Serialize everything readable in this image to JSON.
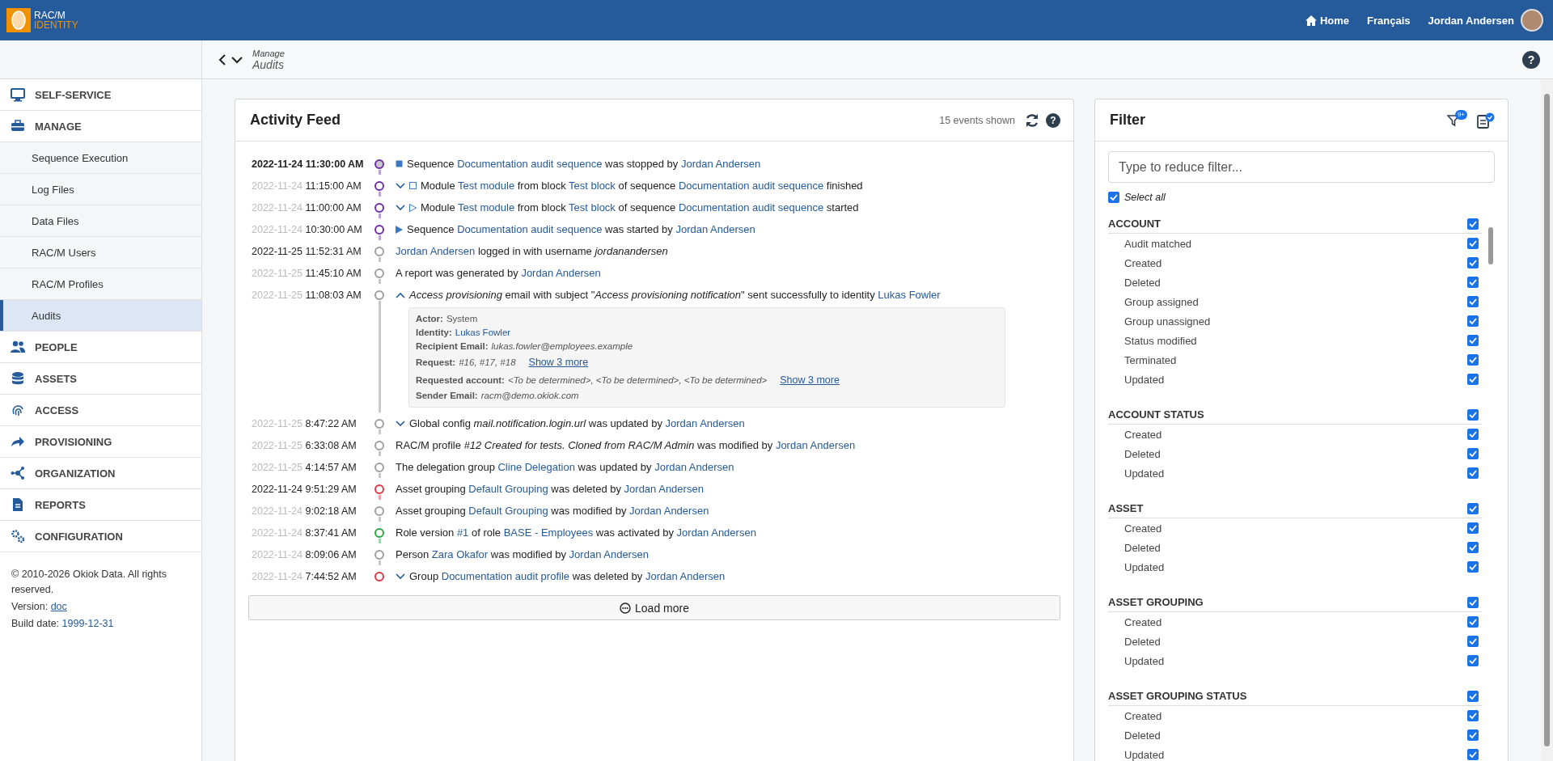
{
  "header": {
    "logo_line1": "RAC/M",
    "logo_line2": "IDENTITY",
    "nav": [
      {
        "label": "Home"
      },
      {
        "label": "Français"
      }
    ],
    "user": "Jordan Andersen"
  },
  "breadcrumb": {
    "parent": "Manage",
    "current": "Audits",
    "help": "?"
  },
  "sidebar": {
    "items": [
      {
        "label": "SELF-SERVICE"
      },
      {
        "label": "MANAGE",
        "children": [
          {
            "label": "Sequence Execution",
            "selected": false
          },
          {
            "label": "Log Files",
            "selected": false
          },
          {
            "label": "Data Files",
            "selected": false
          },
          {
            "label": "RAC/M Users",
            "selected": false
          },
          {
            "label": "RAC/M Profiles",
            "selected": false
          },
          {
            "label": "Audits",
            "selected": true
          }
        ]
      },
      {
        "label": "PEOPLE"
      },
      {
        "label": "ASSETS"
      },
      {
        "label": "ACCESS"
      },
      {
        "label": "PROVISIONING"
      },
      {
        "label": "ORGANIZATION"
      },
      {
        "label": "REPORTS"
      },
      {
        "label": "CONFIGURATION"
      }
    ],
    "footer": {
      "copyright": "© 2010-2026 Okiok Data. All rights reserved.",
      "version_label": "Version:",
      "version_link": "doc",
      "build_label": "Build date:",
      "build_value": "1999-12-31"
    }
  },
  "activity_feed": {
    "title": "Activity Feed",
    "count": "15 events shown",
    "help": "?",
    "load_more": "Load more",
    "events": [
      {
        "date": "2022-11-24",
        "time": "11:30:00 AM",
        "highlighted": true,
        "date_muted": false,
        "color": "#6f2da8",
        "expandable": false,
        "kind": "stop",
        "parts": [
          {
            "kind": "text",
            "text": "Sequence "
          },
          {
            "kind": "link",
            "text": "Documentation audit sequence"
          },
          {
            "kind": "text",
            "text": " was stopped by "
          },
          {
            "kind": "link",
            "text": "Jordan Andersen"
          }
        ]
      },
      {
        "date": "2022-11-24",
        "time": "11:15:00 AM",
        "highlighted": false,
        "date_muted": true,
        "color": "#6f2da8",
        "expandable": true,
        "expanded": false,
        "kind": "finish",
        "parts": [
          {
            "kind": "text",
            "text": "Module "
          },
          {
            "kind": "link",
            "text": "Test module"
          },
          {
            "kind": "text",
            "text": " from block "
          },
          {
            "kind": "link",
            "text": "Test block"
          },
          {
            "kind": "text",
            "text": " of sequence "
          },
          {
            "kind": "link",
            "text": "Documentation audit sequence"
          },
          {
            "kind": "text",
            "text": " finished"
          }
        ]
      },
      {
        "date": "2022-11-24",
        "time": "11:00:00 AM",
        "highlighted": false,
        "date_muted": true,
        "color": "#6f2da8",
        "expandable": true,
        "expanded": false,
        "kind": "begin",
        "parts": [
          {
            "kind": "text",
            "text": "Module "
          },
          {
            "kind": "link",
            "text": "Test module"
          },
          {
            "kind": "text",
            "text": " from block "
          },
          {
            "kind": "link",
            "text": "Test block"
          },
          {
            "kind": "text",
            "text": " of sequence "
          },
          {
            "kind": "link",
            "text": "Documentation audit sequence"
          },
          {
            "kind": "text",
            "text": " started"
          }
        ]
      },
      {
        "date": "2022-11-24",
        "time": "10:30:00 AM",
        "highlighted": false,
        "date_muted": true,
        "color": "#6f2da8",
        "expandable": false,
        "kind": "launch",
        "parts": [
          {
            "kind": "text",
            "text": "Sequence "
          },
          {
            "kind": "link",
            "text": "Documentation audit sequence"
          },
          {
            "kind": "text",
            "text": " was started by "
          },
          {
            "kind": "link",
            "text": "Jordan Andersen"
          }
        ]
      },
      {
        "date": "2022-11-25",
        "time": "11:52:31 AM",
        "highlighted": false,
        "date_muted": false,
        "color": "#9e9e9e",
        "expandable": false,
        "kind": "plain",
        "parts": [
          {
            "kind": "link",
            "text": "Jordan Andersen"
          },
          {
            "kind": "text",
            "text": " logged in with username "
          },
          {
            "kind": "italic",
            "text": "jordanandersen"
          }
        ]
      },
      {
        "date": "2022-11-25",
        "time": "11:45:10 AM",
        "highlighted": false,
        "date_muted": true,
        "color": "#9e9e9e",
        "expandable": false,
        "kind": "plain",
        "parts": [
          {
            "kind": "text",
            "text": "A report was generated by "
          },
          {
            "kind": "link",
            "text": "Jordan Andersen"
          }
        ]
      },
      {
        "date": "2022-11-25",
        "time": "11:08:03 AM",
        "highlighted": false,
        "date_muted": true,
        "color": "#9e9e9e",
        "expandable": true,
        "expanded": true,
        "kind": "plain",
        "parts": [
          {
            "kind": "italic",
            "text": "Access provisioning"
          },
          {
            "kind": "text",
            "text": " email with subject \""
          },
          {
            "kind": "italic",
            "text": "Access provisioning notification"
          },
          {
            "kind": "text",
            "text": "\" sent successfully to identity "
          },
          {
            "kind": "link",
            "text": "Lukas Fowler"
          }
        ],
        "details": [
          {
            "label": "Actor:",
            "value": "System",
            "kind": "text"
          },
          {
            "label": "Identity:",
            "value": "Lukas Fowler",
            "kind": "link"
          },
          {
            "label": "Recipient Email:",
            "value": "lukas.fowler@employees.example",
            "kind": "italic"
          },
          {
            "label": "Request:",
            "value": "#16, #17, #18",
            "kind": "italic",
            "more": "Show 3 more"
          },
          {
            "label": "Requested account:",
            "value": "<To be determined>, <To be determined>, <To be determined>",
            "kind": "italic",
            "more": "Show 3 more"
          },
          {
            "label": "Sender Email:",
            "value": "racm@demo.okiok.com",
            "kind": "italic"
          }
        ]
      },
      {
        "date": "2022-11-25",
        "time": "8:47:22 AM",
        "highlighted": false,
        "date_muted": true,
        "color": "#9e9e9e",
        "expandable": true,
        "expanded": false,
        "kind": "plain",
        "parts": [
          {
            "kind": "text",
            "text": "Global config "
          },
          {
            "kind": "italic",
            "text": "mail.notification.login.url"
          },
          {
            "kind": "text",
            "text": " was updated by "
          },
          {
            "kind": "link",
            "text": "Jordan Andersen"
          }
        ]
      },
      {
        "date": "2022-11-25",
        "time": "6:33:08 AM",
        "highlighted": false,
        "date_muted": true,
        "color": "#9e9e9e",
        "expandable": false,
        "kind": "plain",
        "parts": [
          {
            "kind": "text",
            "text": "RAC/M profile "
          },
          {
            "kind": "italic",
            "text": "#12 Created for tests. Cloned from RAC/M Admin"
          },
          {
            "kind": "text",
            "text": " was modified by "
          },
          {
            "kind": "link",
            "text": "Jordan Andersen"
          }
        ]
      },
      {
        "date": "2022-11-25",
        "time": "4:14:57 AM",
        "highlighted": false,
        "date_muted": true,
        "color": "#9e9e9e",
        "expandable": false,
        "kind": "plain",
        "parts": [
          {
            "kind": "text",
            "text": "The delegation group "
          },
          {
            "kind": "link",
            "text": "Cline Delegation"
          },
          {
            "kind": "text",
            "text": " was updated by "
          },
          {
            "kind": "link",
            "text": "Jordan Andersen"
          }
        ]
      },
      {
        "date": "2022-11-24",
        "time": "9:51:29 AM",
        "highlighted": false,
        "date_muted": false,
        "color": "#dc3545",
        "expandable": false,
        "kind": "plain",
        "parts": [
          {
            "kind": "text",
            "text": "Asset grouping "
          },
          {
            "kind": "link",
            "text": "Default Grouping"
          },
          {
            "kind": "text",
            "text": " was deleted by "
          },
          {
            "kind": "link",
            "text": "Jordan Andersen"
          }
        ]
      },
      {
        "date": "2022-11-24",
        "time": "9:02:18 AM",
        "highlighted": false,
        "date_muted": true,
        "color": "#9e9e9e",
        "expandable": false,
        "kind": "plain",
        "parts": [
          {
            "kind": "text",
            "text": "Asset grouping "
          },
          {
            "kind": "link",
            "text": "Default Grouping"
          },
          {
            "kind": "text",
            "text": " was modified by "
          },
          {
            "kind": "link",
            "text": "Jordan Andersen"
          }
        ]
      },
      {
        "date": "2022-11-24",
        "time": "8:37:41 AM",
        "highlighted": false,
        "date_muted": true,
        "color": "#28a745",
        "expandable": false,
        "kind": "plain",
        "parts": [
          {
            "kind": "text",
            "text": "Role version "
          },
          {
            "kind": "link",
            "text": "#1"
          },
          {
            "kind": "text",
            "text": " of role "
          },
          {
            "kind": "link",
            "text": "BASE - Employees"
          },
          {
            "kind": "text",
            "text": " was activated by "
          },
          {
            "kind": "link",
            "text": "Jordan Andersen"
          }
        ]
      },
      {
        "date": "2022-11-24",
        "time": "8:09:06 AM",
        "highlighted": false,
        "date_muted": true,
        "color": "#9e9e9e",
        "expandable": false,
        "kind": "plain",
        "parts": [
          {
            "kind": "text",
            "text": "Person "
          },
          {
            "kind": "link",
            "text": "Zara Okafor"
          },
          {
            "kind": "text",
            "text": " was modified by "
          },
          {
            "kind": "link",
            "text": "Jordan Andersen"
          }
        ]
      },
      {
        "date": "2022-11-24",
        "time": "7:44:52 AM",
        "highlighted": false,
        "date_muted": true,
        "color": "#dc3545",
        "expandable": true,
        "expanded": false,
        "kind": "plain",
        "parts": [
          {
            "kind": "text",
            "text": "Group "
          },
          {
            "kind": "link",
            "text": "Documentation audit profile"
          },
          {
            "kind": "text",
            "text": " was deleted by "
          },
          {
            "kind": "link",
            "text": "Jordan Andersen"
          }
        ]
      }
    ]
  },
  "filter": {
    "title": "Filter",
    "badge": "9+",
    "placeholder": "Type to reduce filter...",
    "select_all": {
      "label": "Select all",
      "checked": true
    },
    "groups": [
      {
        "name": "ACCOUNT",
        "checked": true,
        "items": [
          {
            "label": "Audit matched",
            "checked": true
          },
          {
            "label": "Created",
            "checked": true
          },
          {
            "label": "Deleted",
            "checked": true
          },
          {
            "label": "Group assigned",
            "checked": true
          },
          {
            "label": "Group unassigned",
            "checked": true
          },
          {
            "label": "Status modified",
            "checked": true
          },
          {
            "label": "Terminated",
            "checked": true
          },
          {
            "label": "Updated",
            "checked": true
          }
        ]
      },
      {
        "name": "ACCOUNT STATUS",
        "checked": true,
        "items": [
          {
            "label": "Created",
            "checked": true
          },
          {
            "label": "Deleted",
            "checked": true
          },
          {
            "label": "Updated",
            "checked": true
          }
        ]
      },
      {
        "name": "ASSET",
        "checked": true,
        "items": [
          {
            "label": "Created",
            "checked": true
          },
          {
            "label": "Deleted",
            "checked": true
          },
          {
            "label": "Updated",
            "checked": true
          }
        ]
      },
      {
        "name": "ASSET GROUPING",
        "checked": true,
        "items": [
          {
            "label": "Created",
            "checked": true
          },
          {
            "label": "Deleted",
            "checked": true
          },
          {
            "label": "Updated",
            "checked": true
          }
        ]
      },
      {
        "name": "ASSET GROUPING STATUS",
        "checked": true,
        "items": [
          {
            "label": "Created",
            "checked": true
          },
          {
            "label": "Deleted",
            "checked": true
          },
          {
            "label": "Updated",
            "checked": true
          }
        ]
      }
    ]
  }
}
